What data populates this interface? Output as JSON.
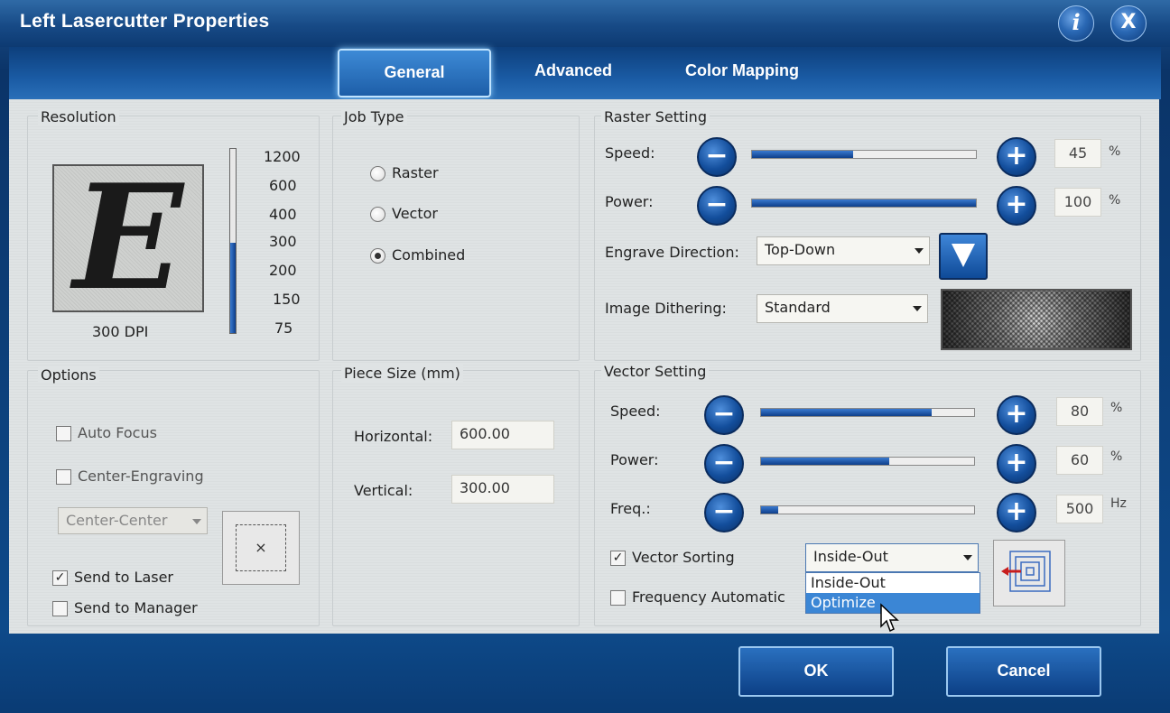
{
  "window": {
    "title": "Left Lasercutter Properties",
    "info_glyph": "i",
    "close_glyph": "X"
  },
  "tabs": [
    "General",
    "Advanced",
    "Color Mapping"
  ],
  "resolution": {
    "title": "Resolution",
    "preview_letter": "E",
    "dpi_label": "300 DPI",
    "ticks": [
      "1200",
      "600",
      "400",
      "300",
      "200",
      "150",
      "75"
    ],
    "selected": "300"
  },
  "job_type": {
    "title": "Job Type",
    "options": [
      "Raster",
      "Vector",
      "Combined"
    ],
    "selected": "Combined"
  },
  "options": {
    "title": "Options",
    "auto_focus": "Auto Focus",
    "center_engraving": "Center-Engraving",
    "center_select": "Center-Center",
    "send_to_laser": "Send to Laser",
    "send_to_manager": "Send to Manager",
    "check_mark": "✓",
    "position_marker": "×"
  },
  "piece_size": {
    "title": "Piece Size (mm)",
    "horizontal_label": "Horizontal:",
    "horizontal_value": "600.00",
    "vertical_label": "Vertical:",
    "vertical_value": "300.00"
  },
  "raster": {
    "title": "Raster Setting",
    "speed_label": "Speed:",
    "speed_value": "45",
    "speed_fraction": 0.45,
    "power_label": "Power:",
    "power_value": "100",
    "power_fraction": 1.0,
    "percent": "%",
    "engrave_label": "Engrave Direction:",
    "engrave_value": "Top-Down",
    "dither_label": "Image Dithering:",
    "dither_value": "Standard"
  },
  "vector": {
    "title": "Vector Setting",
    "speed_label": "Speed:",
    "speed_value": "80",
    "speed_fraction": 0.8,
    "power_label": "Power:",
    "power_value": "60",
    "power_fraction": 0.6,
    "freq_label": "Freq.:",
    "freq_value": "500",
    "freq_fraction": 0.08,
    "percent": "%",
    "hz": "Hz",
    "sorting_label": "Vector Sorting",
    "sorting_value": "Inside-Out",
    "sorting_options": [
      "Inside-Out",
      "Optimize"
    ],
    "highlighted_option": "Optimize",
    "freq_auto_label": "Frequency Automatic"
  },
  "buttons": {
    "ok": "OK",
    "cancel": "Cancel",
    "minus": "−",
    "plus": "+"
  },
  "colors": {
    "accent": "#1d5ea8",
    "highlight": "#3b86d5",
    "panel": "#dfe3e4"
  }
}
